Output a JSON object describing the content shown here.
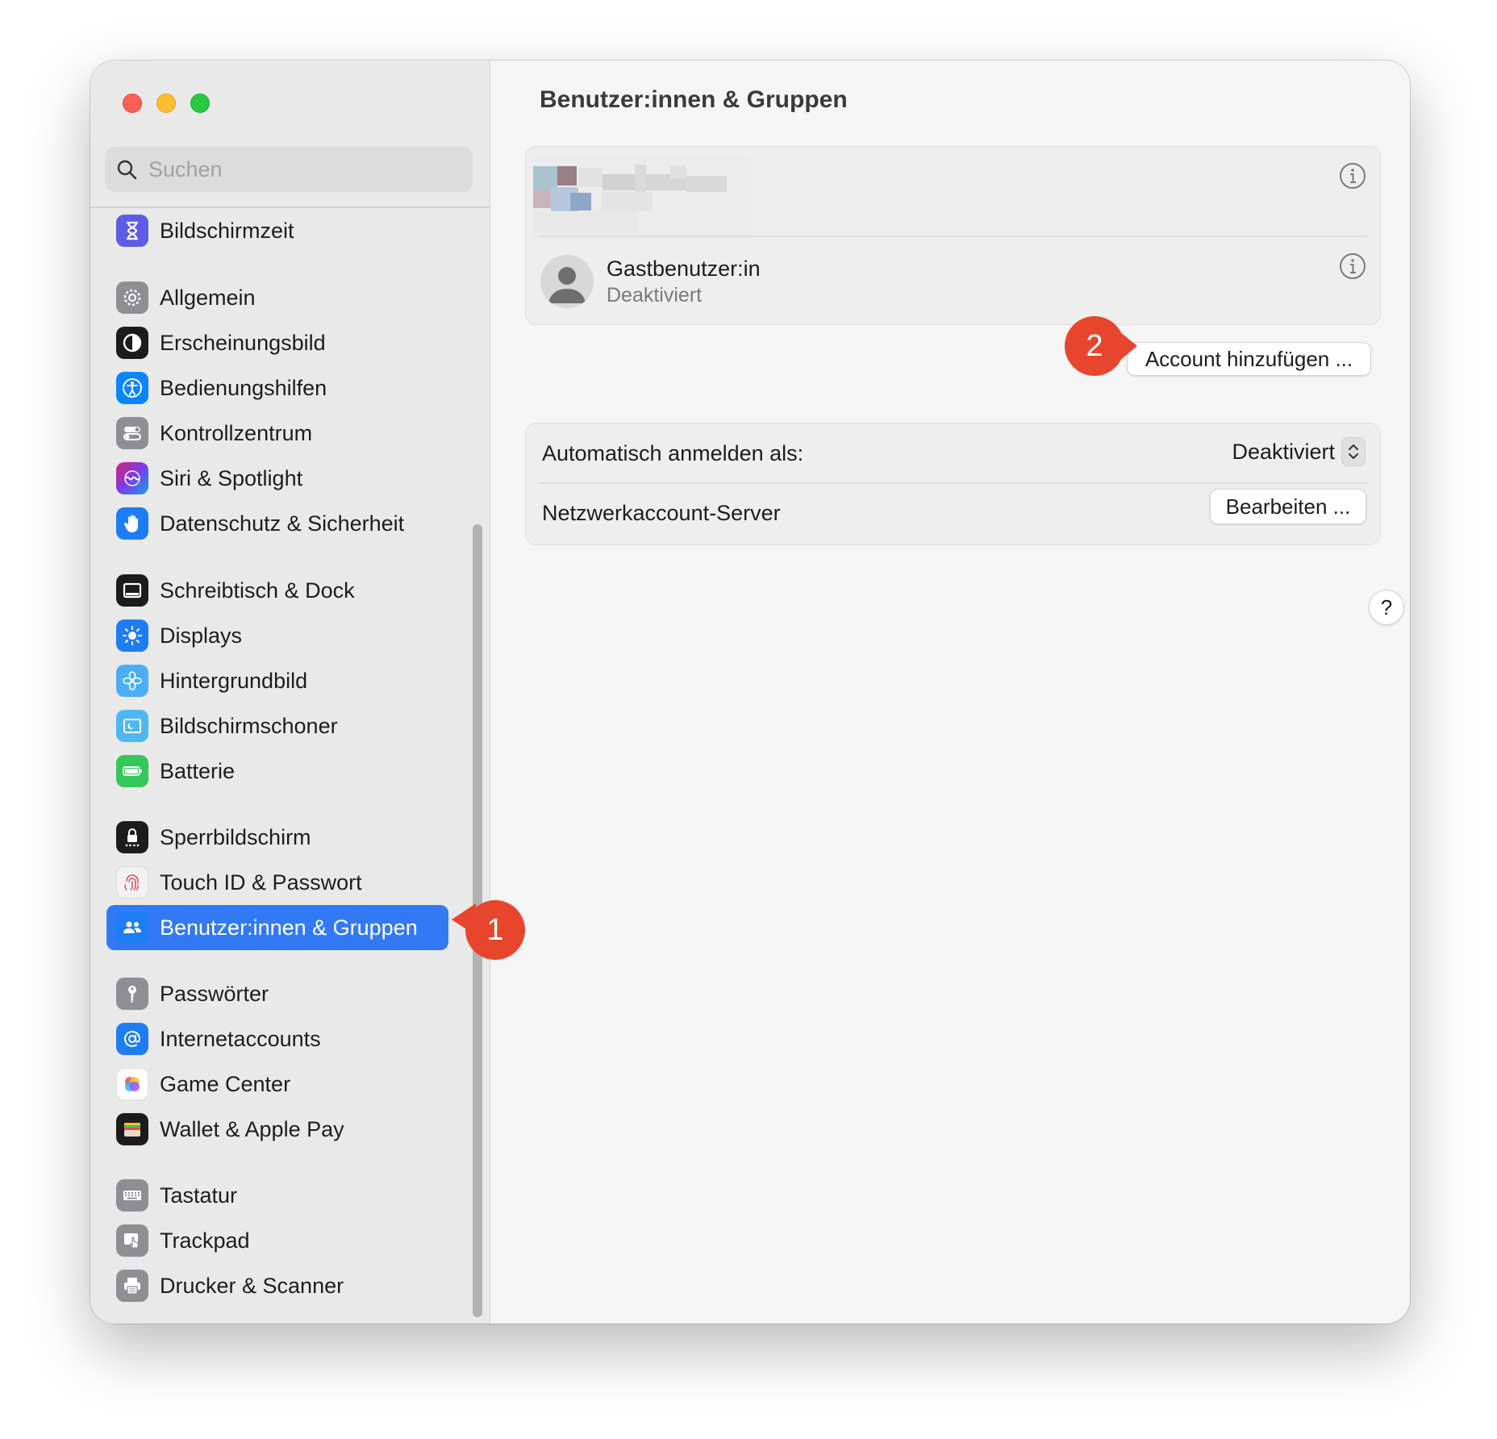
{
  "search": {
    "placeholder": "Suchen"
  },
  "sidebar": {
    "items": [
      {
        "label": "Bildschirmzeit",
        "icon": "hourglass-icon",
        "color": "#5e5ce6"
      },
      {
        "label": "Allgemein",
        "icon": "gear-icon",
        "color": "#8e8e93"
      },
      {
        "label": "Erscheinungsbild",
        "icon": "appearance-icon",
        "color": "#1c1c1e"
      },
      {
        "label": "Bedienungshilfen",
        "icon": "accessibility-icon",
        "color": "#0a84ff"
      },
      {
        "label": "Kontrollzentrum",
        "icon": "toggles-icon",
        "color": "#8e8e93"
      },
      {
        "label": "Siri & Spotlight",
        "icon": "siri-icon",
        "color": "#7a3cf0"
      },
      {
        "label": "Datenschutz & Sicherheit",
        "icon": "hand-icon",
        "color": "#1e7cf5"
      },
      {
        "label": "Schreibtisch & Dock",
        "icon": "dock-icon",
        "color": "#1c1c1e"
      },
      {
        "label": "Displays",
        "icon": "sun-icon",
        "color": "#1e7cf5"
      },
      {
        "label": "Hintergrundbild",
        "icon": "flower-icon",
        "color": "#49aef5"
      },
      {
        "label": "Bildschirmschoner",
        "icon": "screensaver-icon",
        "color": "#4fb7ef"
      },
      {
        "label": "Batterie",
        "icon": "battery-icon",
        "color": "#34c759"
      },
      {
        "label": "Sperrbildschirm",
        "icon": "lock-icon",
        "color": "#1c1c1e"
      },
      {
        "label": "Touch ID & Passwort",
        "icon": "fingerprint-icon",
        "color": "#f2f2f2"
      },
      {
        "label": "Benutzer:innen & Gruppen",
        "icon": "users-icon",
        "color": "#1e7cf5"
      },
      {
        "label": "Passwörter",
        "icon": "key-icon",
        "color": "#8e8e93"
      },
      {
        "label": "Internetaccounts",
        "icon": "at-icon",
        "color": "#1e7cf5"
      },
      {
        "label": "Game Center",
        "icon": "game-center-icon",
        "color": "#ffffff"
      },
      {
        "label": "Wallet & Apple Pay",
        "icon": "wallet-icon",
        "color": "#1c1c1e"
      },
      {
        "label": "Tastatur",
        "icon": "keyboard-icon",
        "color": "#8e8e93"
      },
      {
        "label": "Trackpad",
        "icon": "trackpad-icon",
        "color": "#8e8e93"
      },
      {
        "label": "Drucker & Scanner",
        "icon": "printer-icon",
        "color": "#8e8e93"
      }
    ],
    "selected": "Benutzer:innen & Gruppen"
  },
  "main": {
    "title": "Benutzer:innen & Gruppen",
    "users": {
      "guest_name": "Gastbenutzer:in",
      "guest_status": "Deaktiviert"
    },
    "add_account_label": "Account hinzufügen ...",
    "auto_login_label": "Automatisch anmelden als:",
    "auto_login_value": "Deaktiviert",
    "network_server_label": "Netzwerkaccount-Server",
    "edit_label": "Bearbeiten ...",
    "help_label": "?"
  },
  "callouts": {
    "first": "1",
    "second": "2",
    "color": "#e8452d"
  },
  "colors": {
    "accent": "#3279f6"
  }
}
